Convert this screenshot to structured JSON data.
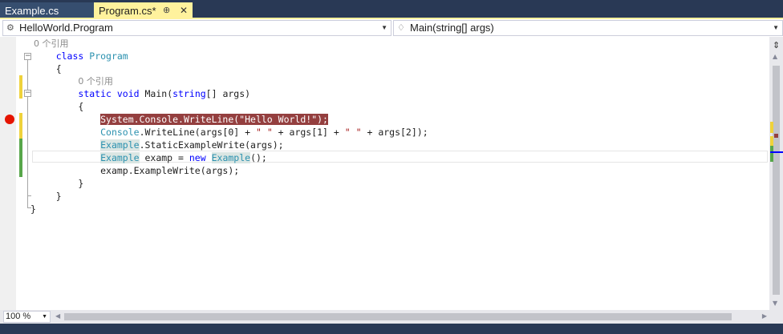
{
  "tabs": [
    {
      "label": "Example.cs",
      "active": false
    },
    {
      "label": "Program.cs*",
      "active": true,
      "pin": "⊕",
      "close": "✕"
    }
  ],
  "nav": {
    "class_combo": "HelloWorld.Program",
    "member_combo": "Main(string[] args)"
  },
  "code": {
    "ref_count": "0 个引用",
    "kw_class": "class",
    "class_name": "Program",
    "brace_open": "{",
    "brace_close": "}",
    "kw_static": "static",
    "kw_void": "void",
    "main_sig": " Main(",
    "kw_string": "string",
    "main_params": "[] args)",
    "bp_line": "System.Console.WriteLine(\"Hello World!\");",
    "l2_type": "Console",
    "l2_pre": ".WriteLine(args[0] + ",
    "l2_s1": "\" \"",
    "l2_mid": " + args[1] + ",
    "l2_s2": "\" \"",
    "l2_post": " + args[2]);",
    "l3_type": "Example",
    "l3_rest": ".StaticExampleWrite(args);",
    "l4_type": "Example",
    "l4_mid": " examp = ",
    "l4_new": "new",
    "l4_type2": "Example",
    "l4_end": "();",
    "l5": "examp.ExampleWrite(args);"
  },
  "zoom": {
    "value": "100 %"
  },
  "icons": {
    "class_icon": "class-icon",
    "method_icon": "method-icon",
    "breakpoint": "breakpoint-icon"
  },
  "colors": {
    "accent_tab": "#fff29d",
    "chrome": "#293955",
    "keyword": "#0000ff",
    "type": "#2b91af",
    "string": "#a31515",
    "breakpoint": "#e51400",
    "breakpoint_highlight": "#943f3f"
  }
}
